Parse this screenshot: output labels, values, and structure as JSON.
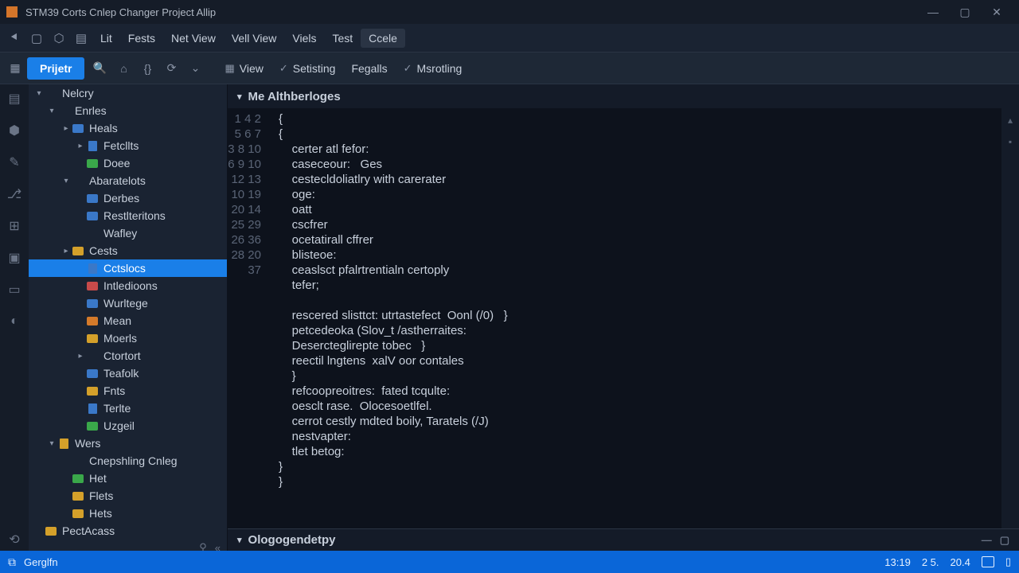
{
  "titlebar": {
    "title": "STM39 Corts  Cnlep Changer  Project Allip"
  },
  "menubar": {
    "items": [
      "Lit",
      "Fests",
      "Net View",
      "Vell View",
      "Viels",
      "Test",
      "Ccele"
    ],
    "active_index": 6
  },
  "toolbar": {
    "tab_label": "Prijetr",
    "items": [
      {
        "icon": "▦",
        "label": "View"
      },
      {
        "icon": "✓",
        "label": "Setisting"
      },
      {
        "icon": "",
        "label": "Fegalls"
      },
      {
        "icon": "✓",
        "label": "Msrotling"
      }
    ]
  },
  "sidebar": {
    "nodes": [
      {
        "d": 0,
        "tw": "▾",
        "ic": "",
        "label": "Nelcry"
      },
      {
        "d": 1,
        "tw": "▾",
        "ic": "",
        "label": "Enrles"
      },
      {
        "d": 2,
        "tw": "▸",
        "ic": "ic-folder-b",
        "label": "Heals"
      },
      {
        "d": 3,
        "tw": "▸",
        "ic": "ic-file-b",
        "label": "Fetcllts"
      },
      {
        "d": 3,
        "tw": "",
        "ic": "ic-folder-g",
        "label": "Doee"
      },
      {
        "d": 2,
        "tw": "▾",
        "ic": "",
        "label": "Abaratelots"
      },
      {
        "d": 3,
        "tw": "",
        "ic": "ic-folder-b",
        "label": "Derbes"
      },
      {
        "d": 3,
        "tw": "",
        "ic": "ic-folder-b",
        "label": "Restlteritons"
      },
      {
        "d": 3,
        "tw": "",
        "ic": "",
        "label": "Wafley"
      },
      {
        "d": 2,
        "tw": "▸",
        "ic": "ic-folder-y",
        "label": "Cests"
      },
      {
        "d": 3,
        "tw": "",
        "ic": "ic-file-b",
        "label": "Cctslocs",
        "sel": true
      },
      {
        "d": 3,
        "tw": "",
        "ic": "ic-folder-r",
        "label": "Intledioons"
      },
      {
        "d": 3,
        "tw": "",
        "ic": "ic-folder-b",
        "label": "Wurltege"
      },
      {
        "d": 3,
        "tw": "",
        "ic": "ic-folder-o",
        "label": "Mean"
      },
      {
        "d": 3,
        "tw": "",
        "ic": "ic-folder-y",
        "label": "Moerls"
      },
      {
        "d": 3,
        "tw": "▸",
        "ic": "",
        "label": "Ctortort"
      },
      {
        "d": 3,
        "tw": "",
        "ic": "ic-folder-b",
        "label": "Teafolk"
      },
      {
        "d": 3,
        "tw": "",
        "ic": "ic-folder-y",
        "label": "Fnts"
      },
      {
        "d": 3,
        "tw": "",
        "ic": "ic-file-b",
        "label": "Terlte"
      },
      {
        "d": 3,
        "tw": "",
        "ic": "ic-folder-g",
        "label": "Uzgeil"
      },
      {
        "d": 1,
        "tw": "▾",
        "ic": "ic-file-y",
        "label": "Wers"
      },
      {
        "d": 2,
        "tw": "",
        "ic": "",
        "label": "Cnepshling Cnleg"
      },
      {
        "d": 2,
        "tw": "",
        "ic": "ic-folder-g",
        "label": "Het"
      },
      {
        "d": 2,
        "tw": "",
        "ic": "ic-folder-y",
        "label": "Flets"
      },
      {
        "d": 2,
        "tw": "",
        "ic": "ic-folder-y",
        "label": "Hets"
      },
      {
        "d": 0,
        "tw": "",
        "ic": "ic-folder-y",
        "label": "PectAcass"
      }
    ]
  },
  "editor": {
    "header": "Me  Althberloges",
    "line_numbers": [
      "1",
      "4",
      "2",
      "5",
      "6",
      "7",
      "3",
      "8",
      "10",
      "6",
      "9",
      "10",
      "12",
      "13",
      "10",
      "19",
      "20",
      "14",
      "25",
      "29",
      "26",
      "36",
      "28",
      "20",
      "37"
    ],
    "lines": [
      "{",
      "{",
      "    certer atl fefor:",
      "    caseceour:   Ges",
      "    cestecldoliatlry with carerater",
      "    oge:",
      "    oatt",
      "    cscfrer",
      "    ocetatirall cffrer",
      "    blisteoe:",
      "    ceaslsct pfalrtrentialn certoply",
      "    tefer;",
      "",
      "    rescered slisttct: utrtastefect  Oonl (/0)   }",
      "    petcedeoka (Slov_t /astherraites:",
      "    Desercteglirepte tobec   }",
      "    reectil lngtens  xalV oor contales",
      "    }",
      "    refcoopreoitres:  fated tcqulte:",
      "    oesclt rase.  Olocesoetlfel.",
      "    cerrot cestly mdted boily, Taratels (/J)",
      "    nestvapter:",
      "    tlet betog:",
      "}",
      "}"
    ],
    "panel_title": "Ologogendetpy"
  },
  "statusbar": {
    "left_label": "Gerglfn",
    "right_items": [
      "13:19",
      "2 5.",
      "20.4"
    ]
  }
}
